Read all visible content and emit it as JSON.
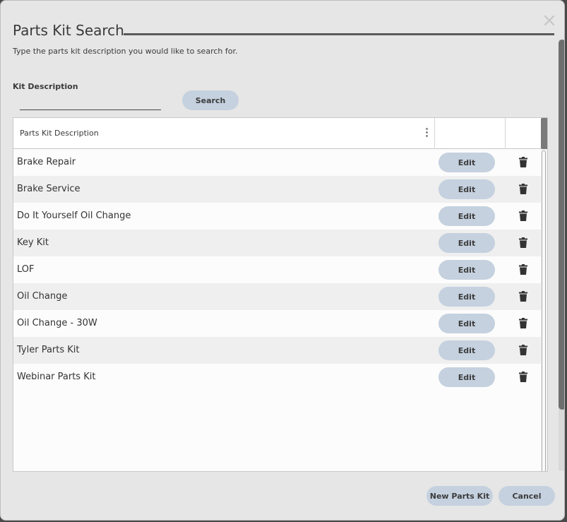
{
  "dialog": {
    "title": "Parts Kit Search",
    "instructions": "Type the parts kit description you would like to search for."
  },
  "search": {
    "label": "Kit Description",
    "value": "",
    "button_label": "Search"
  },
  "grid": {
    "column_header": "Parts Kit Description",
    "edit_label": "Edit",
    "rows": [
      {
        "description": "Brake Repair"
      },
      {
        "description": "Brake Service"
      },
      {
        "description": "Do It Yourself Oil Change"
      },
      {
        "description": "Key Kit"
      },
      {
        "description": "LOF"
      },
      {
        "description": "Oil Change"
      },
      {
        "description": "Oil Change - 30W"
      },
      {
        "description": "Tyler Parts Kit"
      },
      {
        "description": "Webinar Parts Kit"
      }
    ]
  },
  "footer": {
    "new_label": "New Parts Kit",
    "cancel_label": "Cancel"
  },
  "icons": {
    "close": "close-icon",
    "column_menu": "vertical-dots-icon",
    "delete": "trash-icon"
  },
  "colors": {
    "button_bg": "#c5d1df",
    "dialog_bg": "#e6e6e6"
  }
}
